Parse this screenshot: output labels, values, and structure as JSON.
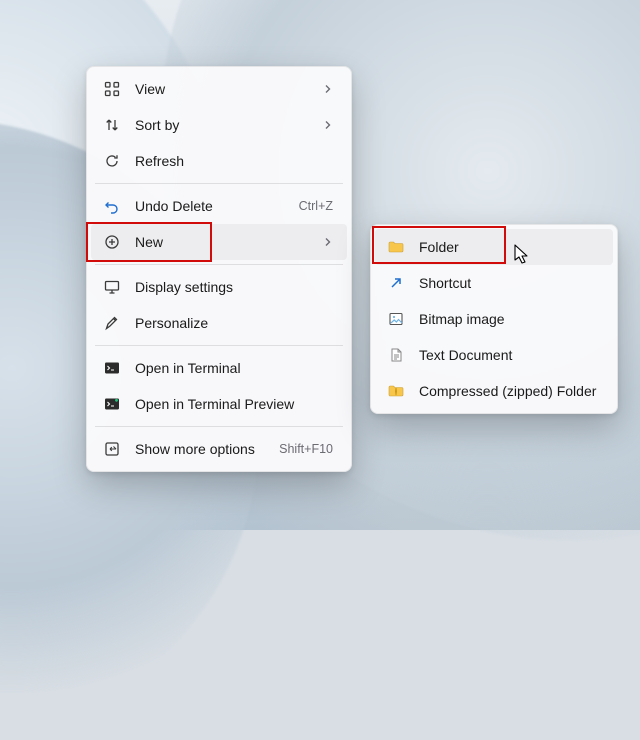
{
  "context_menu": {
    "items": [
      {
        "id": "view",
        "label": "View",
        "submenu": true
      },
      {
        "id": "sort",
        "label": "Sort by",
        "submenu": true
      },
      {
        "id": "refresh",
        "label": "Refresh"
      },
      "---",
      {
        "id": "undo",
        "label": "Undo Delete",
        "accel": "Ctrl+Z"
      },
      {
        "id": "new",
        "label": "New",
        "submenu": true,
        "hover": true,
        "highlighted": true
      },
      "---",
      {
        "id": "display",
        "label": "Display settings"
      },
      {
        "id": "personalize",
        "label": "Personalize"
      },
      "---",
      {
        "id": "terminal",
        "label": "Open in Terminal"
      },
      {
        "id": "terminal-preview",
        "label": "Open in Terminal Preview"
      },
      "---",
      {
        "id": "more",
        "label": "Show more options",
        "accel": "Shift+F10"
      }
    ]
  },
  "new_submenu": {
    "items": [
      {
        "id": "folder",
        "label": "Folder",
        "hover": true,
        "highlighted": true
      },
      {
        "id": "shortcut",
        "label": "Shortcut"
      },
      {
        "id": "bitmap",
        "label": "Bitmap image"
      },
      {
        "id": "textdoc",
        "label": "Text Document"
      },
      {
        "id": "zip",
        "label": "Compressed (zipped) Folder"
      }
    ]
  }
}
